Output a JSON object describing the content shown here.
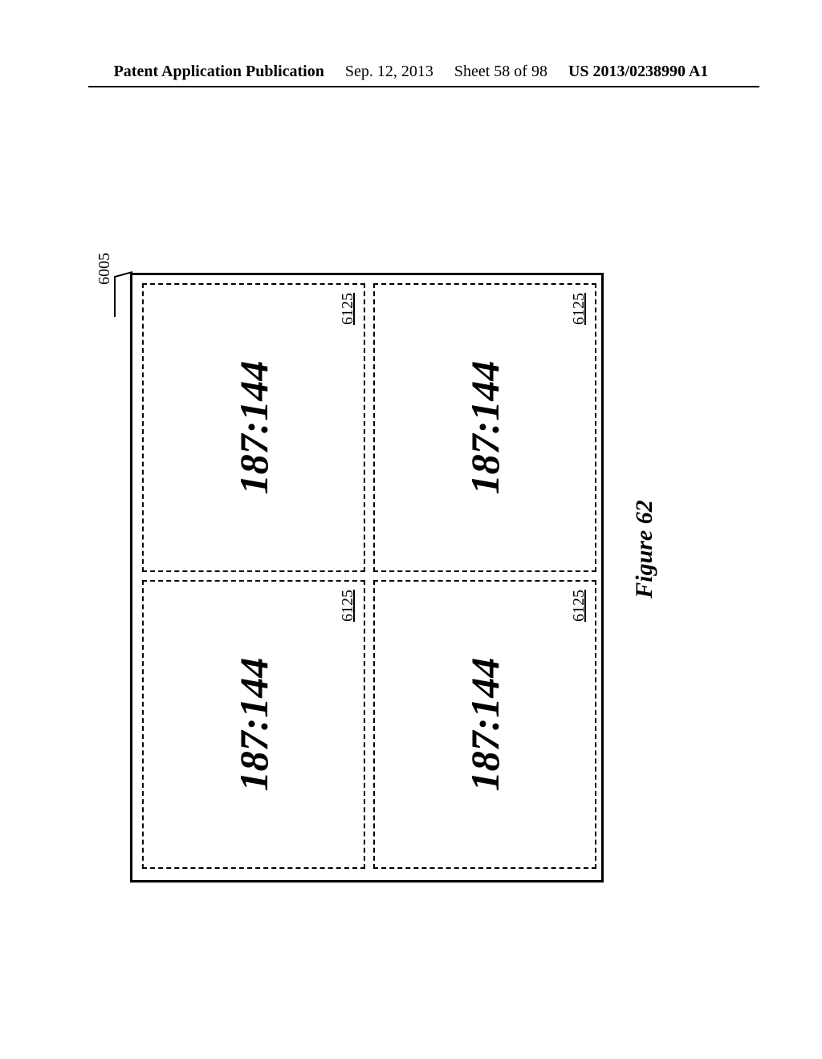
{
  "header": {
    "pub_type": "Patent Application Publication",
    "date": "Sep. 12, 2013",
    "sheet": "Sheet 58 of 98",
    "pub_number": "US 2013/0238990 A1"
  },
  "figure": {
    "frame_ref": "6005",
    "caption": "Figure 62",
    "cells": [
      {
        "ratio": "187:144",
        "ref": "6125"
      },
      {
        "ratio": "187:144",
        "ref": "6125"
      },
      {
        "ratio": "187:144",
        "ref": "6125"
      },
      {
        "ratio": "187:144",
        "ref": "6125"
      }
    ]
  }
}
